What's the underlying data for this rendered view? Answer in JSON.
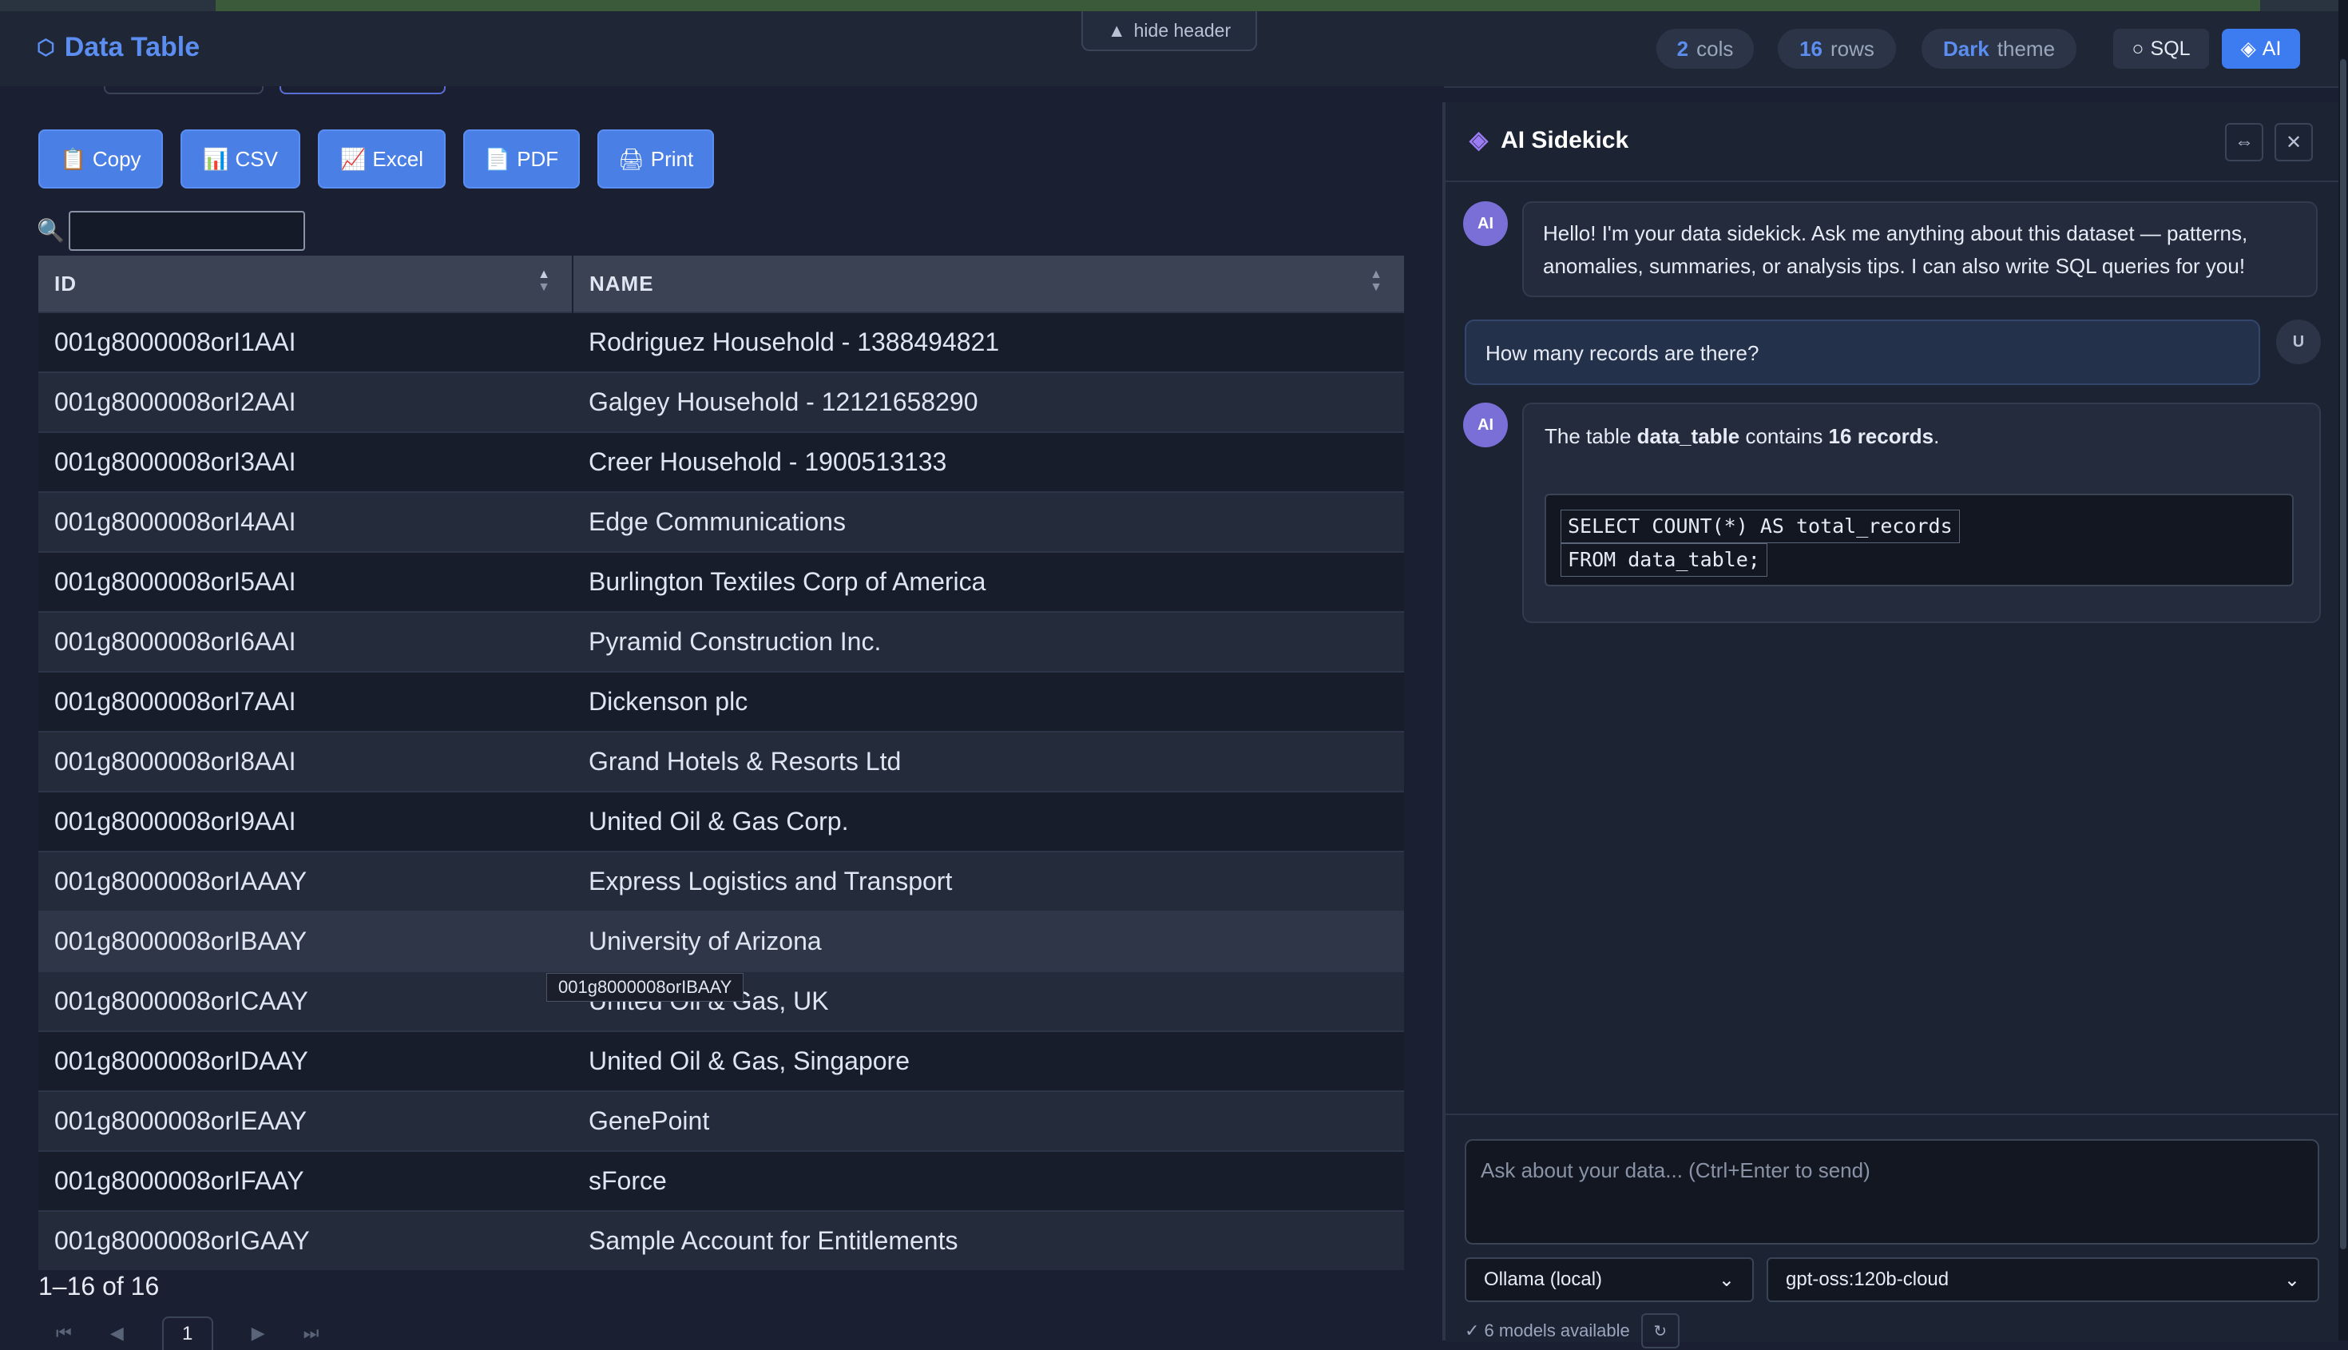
{
  "header": {
    "app_title": "Data Table",
    "hide_header_label": "hide header",
    "cols_value": "2",
    "cols_label": "cols",
    "rows_value": "16",
    "rows_label": "rows",
    "theme_value": "Dark",
    "theme_label": "theme",
    "sql_label": "SQL",
    "ai_label": "AI"
  },
  "toolbar": {
    "copy_label": "Copy",
    "csv_label": "CSV",
    "excel_label": "Excel",
    "pdf_label": "PDF",
    "print_label": "Print"
  },
  "search": {
    "value": ""
  },
  "table": {
    "columns": [
      "ID",
      "NAME"
    ],
    "rows": [
      [
        "001g8000008orI1AAI",
        "Rodriguez Household - 1388494821"
      ],
      [
        "001g8000008orI2AAI",
        "Galgey Household - 12121658290"
      ],
      [
        "001g8000008orI3AAI",
        "Creer Household - 1900513133"
      ],
      [
        "001g8000008orI4AAI",
        "Edge Communications"
      ],
      [
        "001g8000008orI5AAI",
        "Burlington Textiles Corp of America"
      ],
      [
        "001g8000008orI6AAI",
        "Pyramid Construction Inc."
      ],
      [
        "001g8000008orI7AAI",
        "Dickenson plc"
      ],
      [
        "001g8000008orI8AAI",
        "Grand Hotels & Resorts Ltd"
      ],
      [
        "001g8000008orI9AAI",
        "United Oil & Gas Corp."
      ],
      [
        "001g8000008orIAAAY",
        "Express Logistics and Transport"
      ],
      [
        "001g8000008orIBAAY",
        "University of Arizona"
      ],
      [
        "001g8000008orICAAY",
        "United Oil & Gas, UK"
      ],
      [
        "001g8000008orIDAAY",
        "United Oil & Gas, Singapore"
      ],
      [
        "001g8000008orIEAAY",
        "GenePoint"
      ],
      [
        "001g8000008orIFAAY",
        "sForce"
      ],
      [
        "001g8000008orIGAAY",
        "Sample Account for Entitlements"
      ]
    ],
    "tooltip": "001g8000008orIBAAY"
  },
  "pager": {
    "info": "1–16 of 16",
    "current_page": "1"
  },
  "sidekick": {
    "title": "AI Sidekick",
    "ai_avatar": "AI",
    "user_avatar": "U",
    "greeting": "Hello! I'm your data sidekick. Ask me anything about this dataset — patterns, anomalies, summaries, or analysis tips. I can also write SQL queries for you!",
    "user_question": "How many records are there?",
    "answer_prefix": "The table ",
    "answer_table": "data_table",
    "answer_mid": " contains ",
    "answer_count": "16 records",
    "answer_suffix": ".",
    "code_line1": "SELECT COUNT(*) AS total_records",
    "code_line2": "FROM data_table;",
    "composer_placeholder": "Ask about your data... (Ctrl+Enter to send)",
    "provider_selected": "Ollama (local)",
    "model_selected": "gpt-oss:120b-cloud",
    "models_available": "✓ 6 models available"
  },
  "icons": {
    "app": "hexagon-icon",
    "sidekick": "diamond-icon",
    "expand": "expand-horizontal-icon",
    "close": "close-icon",
    "search": "magnifier-icon",
    "refresh": "refresh-icon"
  },
  "colors": {
    "accent": "#3d7cf0",
    "background": "#1a2031",
    "panel": "#1c2333"
  }
}
